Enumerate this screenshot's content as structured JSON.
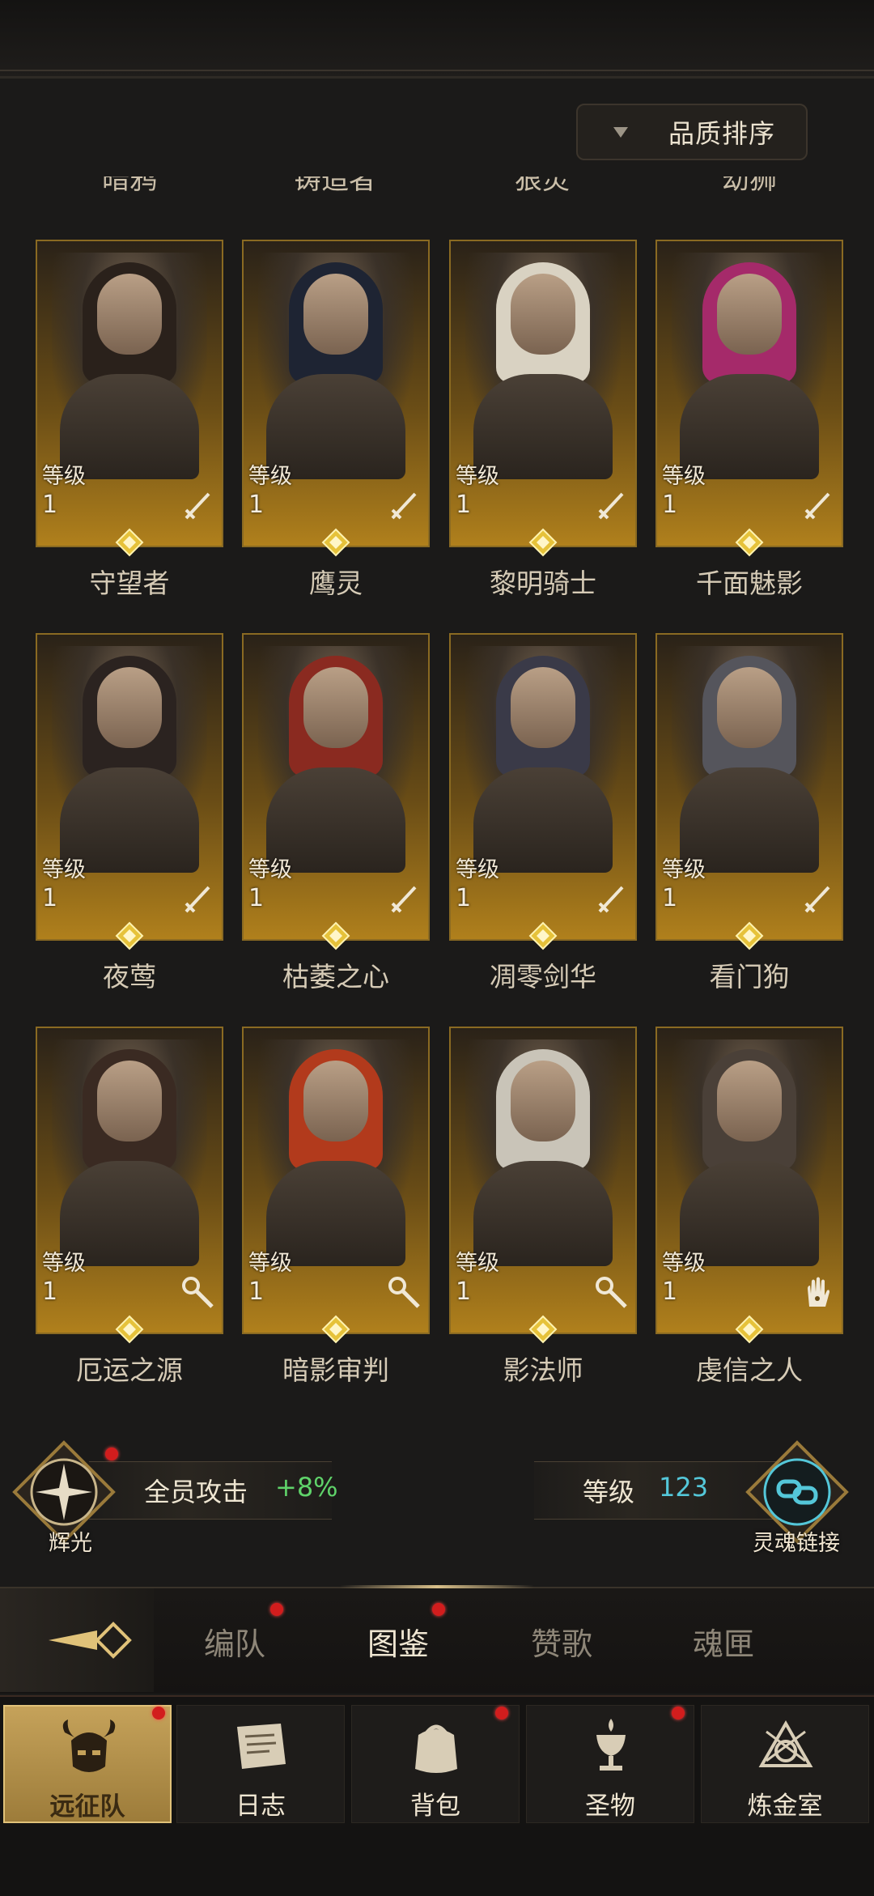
{
  "sort": {
    "label": "品质排序"
  },
  "cut_row": [
    "暗鸦",
    "铸造者",
    "狠灵",
    "幼狮"
  ],
  "level_label": "等级",
  "heroes": [
    {
      "name": "守望者",
      "level": "1",
      "weapon": "sword"
    },
    {
      "name": "鹰灵",
      "level": "1",
      "weapon": "sword"
    },
    {
      "name": "黎明骑士",
      "level": "1",
      "weapon": "sword"
    },
    {
      "name": "千面魅影",
      "level": "1",
      "weapon": "sword"
    },
    {
      "name": "夜莺",
      "level": "1",
      "weapon": "sword"
    },
    {
      "name": "枯萎之心",
      "level": "1",
      "weapon": "sword"
    },
    {
      "name": "凋零剑华",
      "level": "1",
      "weapon": "sword"
    },
    {
      "name": "看门狗",
      "level": "1",
      "weapon": "sword"
    },
    {
      "name": "厄运之源",
      "level": "1",
      "weapon": "staff"
    },
    {
      "name": "暗影审判",
      "level": "1",
      "weapon": "staff"
    },
    {
      "name": "影法师",
      "level": "1",
      "weapon": "staff"
    },
    {
      "name": "虔信之人",
      "level": "1",
      "weapon": "hand"
    }
  ],
  "radiance": {
    "label": "辉光",
    "stat_label": "全员攻击",
    "stat_value": "+8%"
  },
  "soul_link": {
    "label": "灵魂链接",
    "level_label": "等级",
    "level_value": "123"
  },
  "tabs": [
    {
      "label": "编队",
      "dot": true
    },
    {
      "label": "图鉴",
      "dot": true,
      "active": true
    },
    {
      "label": "赞歌",
      "dot": false
    },
    {
      "label": "魂匣",
      "dot": false
    }
  ],
  "nav": [
    {
      "label": "远征队",
      "icon": "helmet-icon",
      "active": true,
      "dot": true
    },
    {
      "label": "日志",
      "icon": "scroll-icon",
      "dot": false
    },
    {
      "label": "背包",
      "icon": "bag-icon",
      "dot": true
    },
    {
      "label": "圣物",
      "icon": "chalice-icon",
      "dot": true
    },
    {
      "label": "炼金室",
      "icon": "alchemy-icon",
      "dot": false
    }
  ],
  "colors": {
    "accent": "#b0801c",
    "stat_green": "#5fd36a",
    "level_cyan": "#54c7d9",
    "dot_red": "#d21d1d"
  }
}
